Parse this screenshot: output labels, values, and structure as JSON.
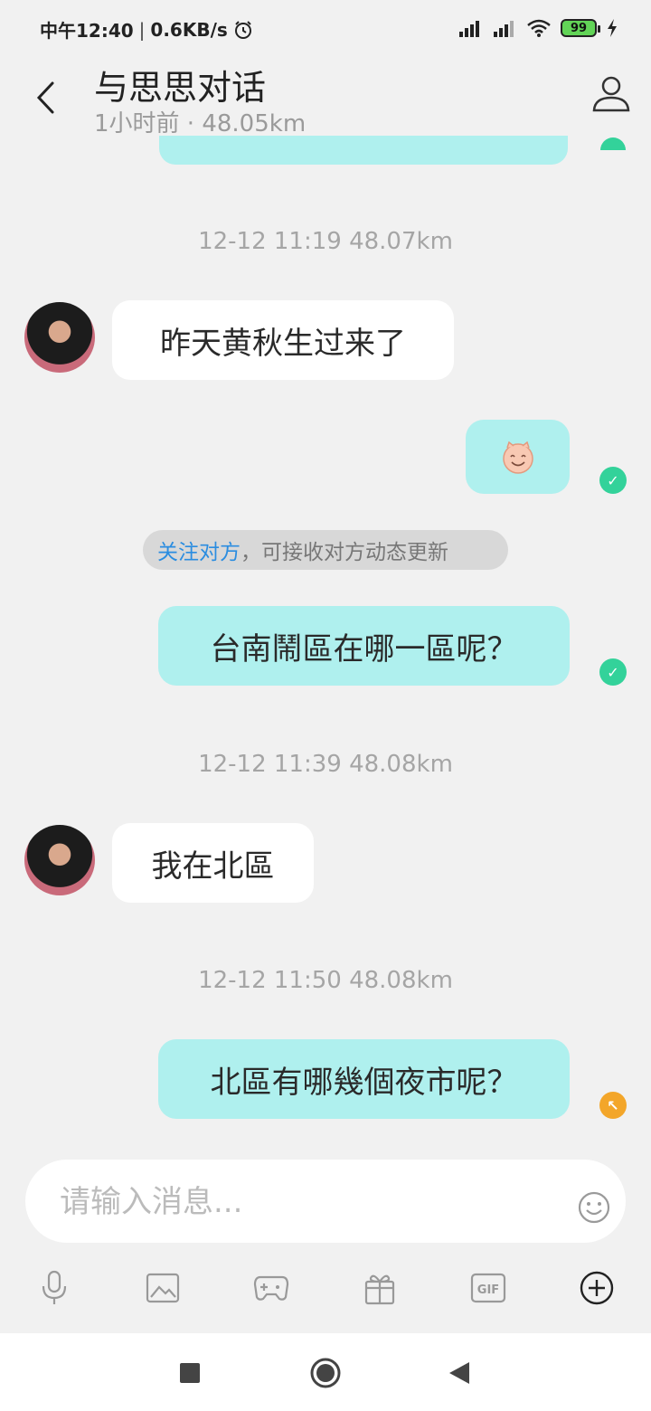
{
  "status_bar": {
    "time": "中午12:40",
    "speed": "0.6KB/s",
    "battery": "99",
    "icons": [
      "alarm-icon",
      "signal-icon",
      "wifi-icon",
      "battery-icon",
      "charging-icon"
    ]
  },
  "header": {
    "title": "与思思对话",
    "subtitle": "1小时前 · 48.05km"
  },
  "messages": {
    "ts1": "12-12 11:19  48.07km",
    "m1": "昨天黄秋生过来了",
    "notice_link": "关注对方",
    "notice_text": "，可接收对方动态更新",
    "m3": "台南鬧區在哪一區呢？",
    "ts2": "12-12 11:39  48.08km",
    "m4": "我在北區",
    "ts3": "12-12 11:50  48.08km",
    "m5": "北區有哪幾個夜市呢？"
  },
  "input": {
    "placeholder": "请输入消息..."
  },
  "toolbar": {
    "items": [
      "mic-icon",
      "image-icon",
      "game-icon",
      "gift-icon",
      "gif-icon",
      "plus-icon"
    ],
    "gif_label": "GIF"
  },
  "colors": {
    "outgoing_bubble": "#aff0ee",
    "incoming_bubble": "#ffffff",
    "sent_ok": "#33d29a",
    "pending": "#f3a62a",
    "link": "#2b8de0"
  }
}
